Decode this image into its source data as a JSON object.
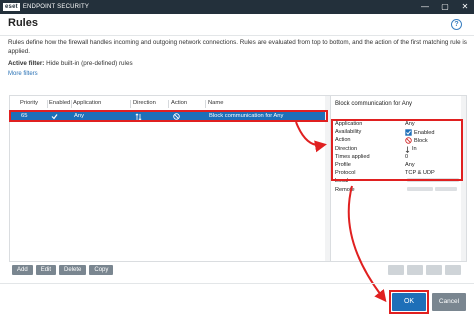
{
  "window": {
    "logo": "eset",
    "app_title": "ENDPOINT SECURITY",
    "minimize_glyph": "—",
    "maximize_glyph": "▢",
    "close_glyph": "✕"
  },
  "header": {
    "title": "Rules",
    "help_glyph": "?"
  },
  "description": "Rules define how the firewall handles incoming and outgoing network connections. Rules are evaluated from top to bottom, and the action of the first matching rule is applied.",
  "filter": {
    "label": "Active filter:",
    "value": "Hide built-in (pre-defined) rules",
    "more_filters": "More filters"
  },
  "table": {
    "columns": [
      "Priority",
      "Enabled",
      "Application",
      "Direction",
      "Action",
      "Name"
    ],
    "rows": [
      {
        "priority": "65",
        "enabled": "checked",
        "application": "Any",
        "direction": "in-out",
        "action": "block",
        "name": "Block communication for Any"
      }
    ]
  },
  "details": {
    "title": "Block communication for Any",
    "rows": [
      {
        "key": "Application",
        "value": "Any"
      },
      {
        "key": "Availability",
        "value": "Enabled"
      },
      {
        "key": "Action",
        "value": "Block"
      },
      {
        "key": "Direction",
        "value": "In"
      },
      {
        "key": "Times applied",
        "value": "0"
      },
      {
        "key": "Profile",
        "value": "Any"
      },
      {
        "key": "Protocol",
        "value": "TCP & UDP"
      },
      {
        "key": "Local",
        "value": ""
      },
      {
        "key": "Remote",
        "value": ""
      }
    ]
  },
  "buttons": {
    "add": "Add",
    "edit": "Edit",
    "delete": "Delete",
    "copy": "Copy",
    "ok": "OK",
    "cancel": "Cancel"
  },
  "colors": {
    "accent": "#1e6fb8",
    "annotation": "#e02020",
    "titlebar": "#23303b"
  }
}
